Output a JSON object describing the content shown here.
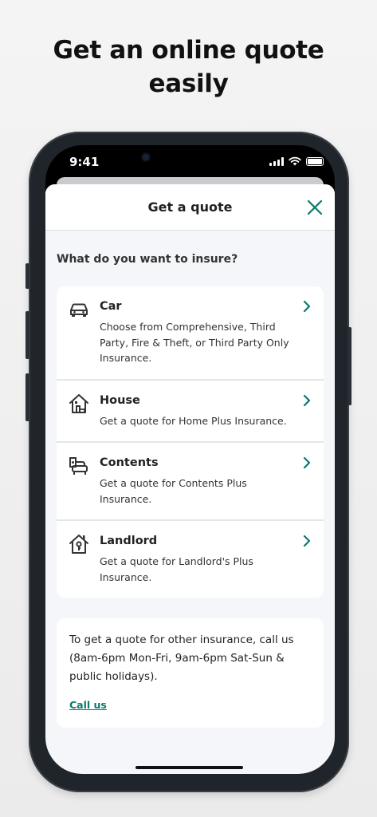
{
  "headline": {
    "line1": "Get an online quote",
    "line2": "easily"
  },
  "status_bar": {
    "time": "9:41"
  },
  "sheet": {
    "title": "Get a quote",
    "question": "What do you want to insure?",
    "items": [
      {
        "title": "Car",
        "description": "Choose from Comprehensive, Third Party, Fire & Theft, or Third Party Only Insurance.",
        "icon": "car-icon"
      },
      {
        "title": "House",
        "description": "Get a quote for Home Plus Insurance.",
        "icon": "house-icon"
      },
      {
        "title": "Contents",
        "description": "Get a quote for Contents Plus Insurance.",
        "icon": "contents-icon"
      },
      {
        "title": "Landlord",
        "description": "Get a quote for Landlord's Plus Insurance.",
        "icon": "landlord-icon"
      }
    ],
    "info_text": "To get a quote for other insurance, call us (8am-6pm Mon-Fri, 9am-6pm Sat-Sun & public holidays).",
    "call_link": "Call us"
  },
  "colors": {
    "accent": "#0a7a6c",
    "phone_frame": "#20252b",
    "sheet_bg": "#f5f6f9"
  }
}
